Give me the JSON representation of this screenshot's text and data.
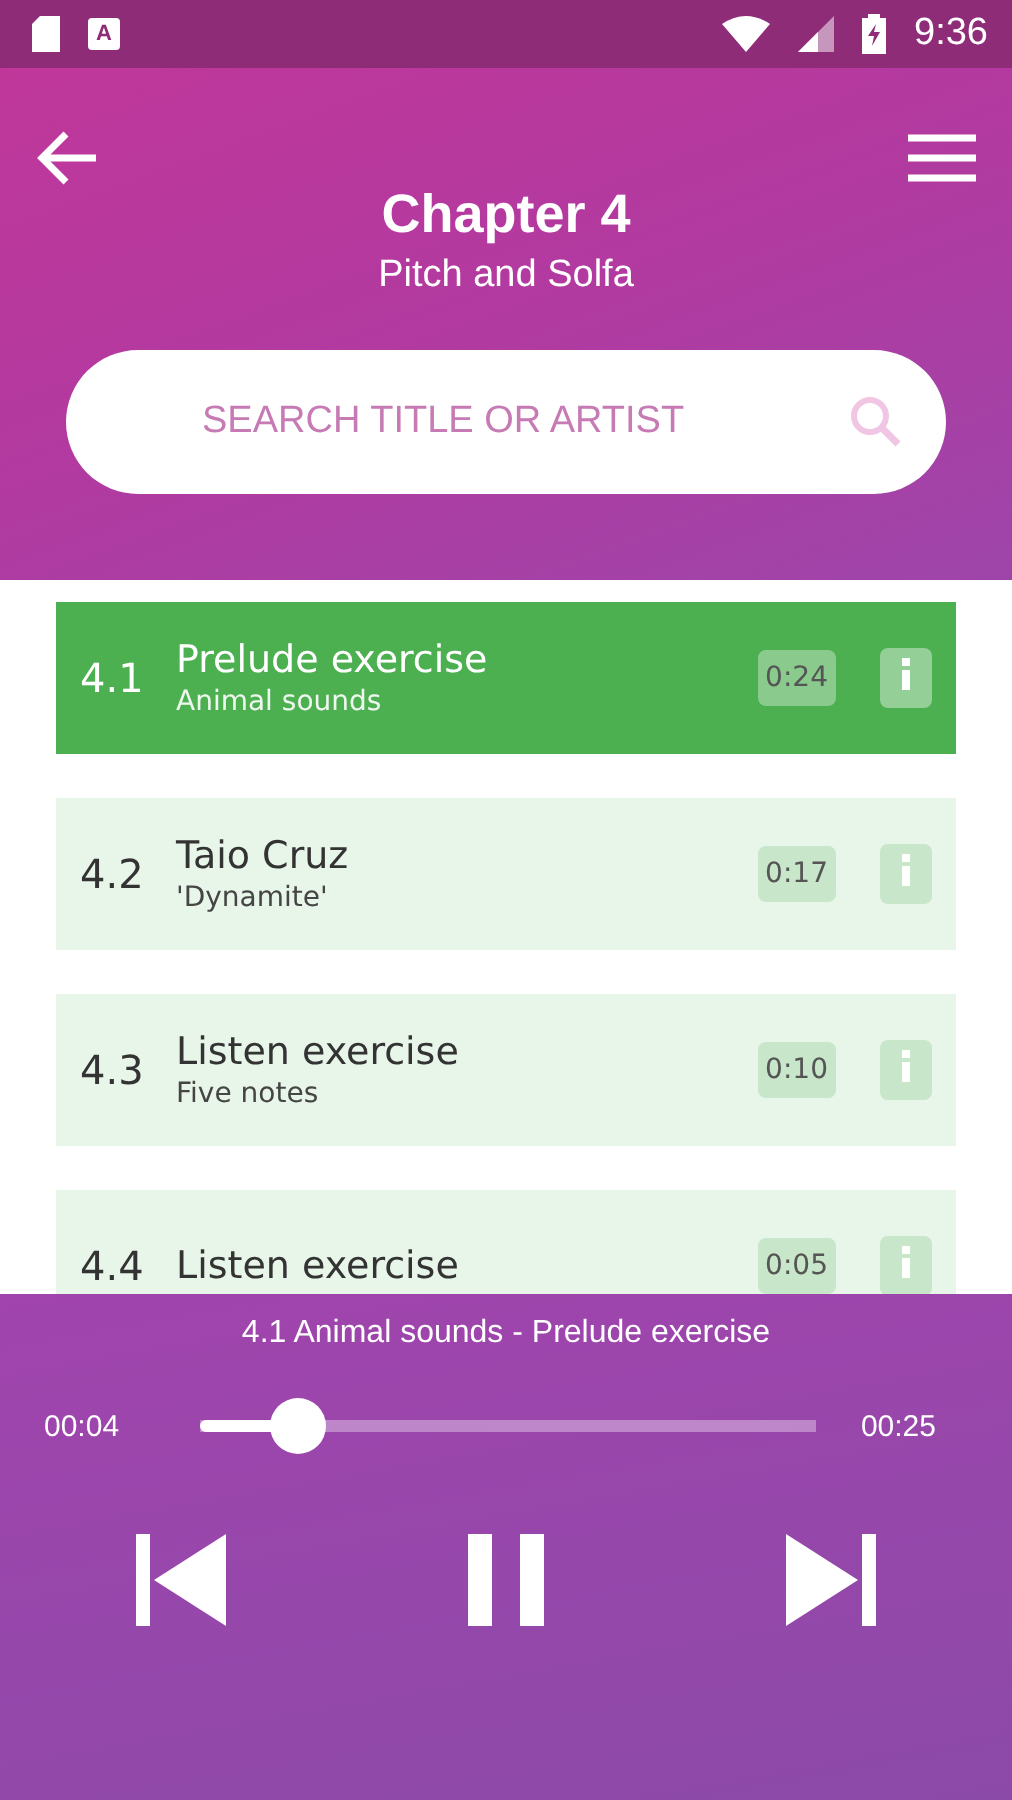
{
  "status_bar": {
    "notification": "A",
    "time": "9:36"
  },
  "header": {
    "title": "Chapter 4",
    "subtitle": "Pitch and Solfa"
  },
  "search": {
    "placeholder": "SEARCH TITLE OR ARTIST"
  },
  "tracks": [
    {
      "number": "4.1",
      "title": "Prelude exercise",
      "subtitle": "Animal sounds",
      "duration": "0:24",
      "selected": true
    },
    {
      "number": "4.2",
      "title": "Taio Cruz",
      "subtitle": "'Dynamite'",
      "duration": "0:17",
      "selected": false
    },
    {
      "number": "4.3",
      "title": "Listen exercise",
      "subtitle": "Five notes",
      "duration": "0:10",
      "selected": false
    },
    {
      "number": "4.4",
      "title": "Listen exercise",
      "duration": "0:05",
      "selected": false
    }
  ],
  "player": {
    "now_playing": "4.1 Animal sounds - Prelude exercise",
    "elapsed": "00:04",
    "total": "00:25",
    "level": 0.16,
    "playing": true
  }
}
